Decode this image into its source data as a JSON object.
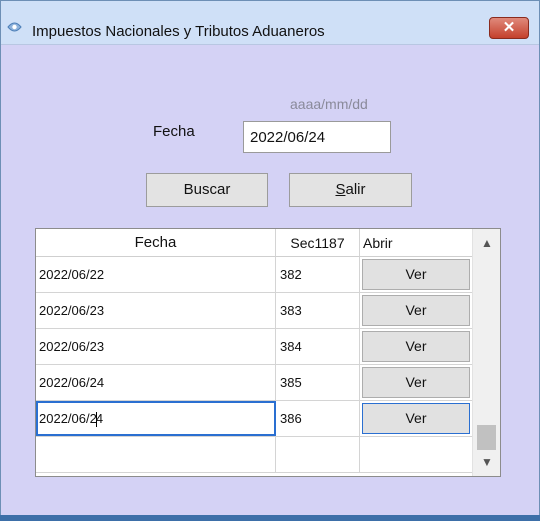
{
  "window": {
    "title": "Impuestos Nacionales y Tributos Aduaneros",
    "close_glyph": "✕"
  },
  "form": {
    "date_hint": "aaaa/mm/dd",
    "fecha_label": "Fecha",
    "fecha_value": "2022/06/24",
    "buscar_label": "Buscar",
    "salir_accel": "S",
    "salir_rest": "alir"
  },
  "grid": {
    "columns": [
      "Fecha",
      "Sec1187",
      "Abrir"
    ],
    "rows": [
      {
        "fecha": "2022/06/22",
        "sec": "382",
        "action": "Ver"
      },
      {
        "fecha": "2022/06/23",
        "sec": "383",
        "action": "Ver"
      },
      {
        "fecha": "2022/06/23",
        "sec": "384",
        "action": "Ver"
      },
      {
        "fecha": "2022/06/24",
        "sec": "385",
        "action": "Ver"
      },
      {
        "fecha_before_caret": "2022/06/2",
        "fecha_after_caret": "4",
        "sec": "386",
        "action": "Ver"
      }
    ],
    "scroll_up_glyph": "▲",
    "scroll_down_glyph": "▼"
  }
}
